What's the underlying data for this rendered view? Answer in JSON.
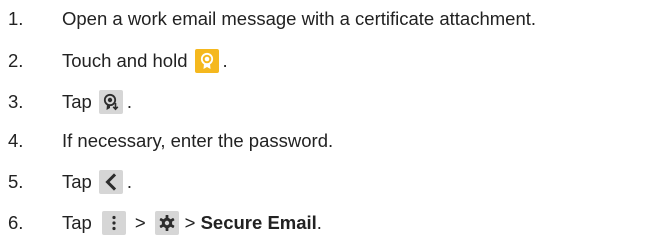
{
  "steps": [
    {
      "number": "1.",
      "text": "Open a work email message with a certificate attachment."
    },
    {
      "number": "2.",
      "text_before": "Touch and hold",
      "icon": "certificate-icon",
      "text_after": "."
    },
    {
      "number": "3.",
      "text_before": "Tap",
      "icon": "import-certificate-icon",
      "text_after": "."
    },
    {
      "number": "4.",
      "text": "If necessary, enter the password."
    },
    {
      "number": "5.",
      "text_before": "Tap",
      "icon": "back-arrow-icon",
      "text_after": "."
    },
    {
      "number": "6.",
      "text_before": "Tap",
      "icon_menu": "more-menu-icon",
      "separator_1": ">",
      "icon_settings": "settings-gear-icon",
      "separator_2": "> ",
      "bold_text": "Secure Email",
      "text_after": "."
    }
  ],
  "colors": {
    "text": "#222222",
    "icon_yellow": "#f5b81e",
    "icon_grey": "#d6d6d6",
    "icon_dark": "#2c2c2c"
  }
}
